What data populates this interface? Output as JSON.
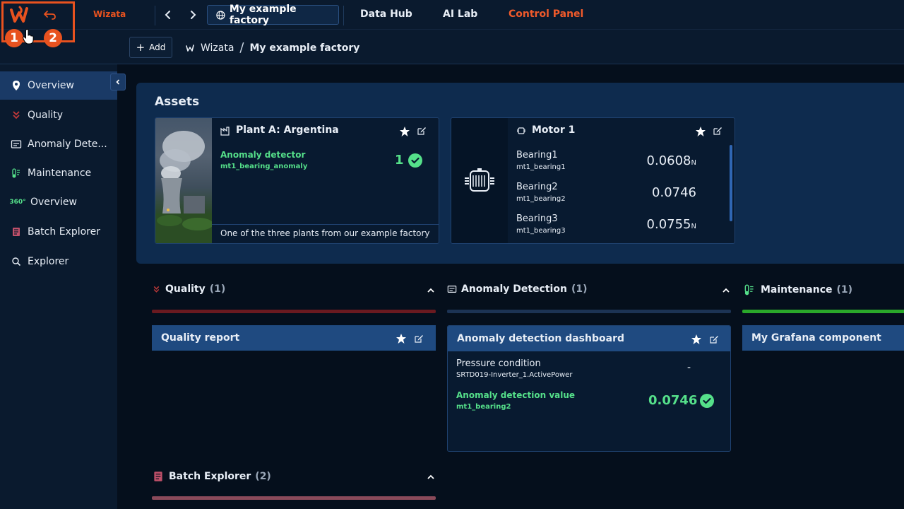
{
  "topbar": {
    "brand": "Wizata",
    "badges": [
      "1",
      "2"
    ],
    "factory_label": "My example factory",
    "nav": [
      {
        "label": "Data Hub",
        "active": false
      },
      {
        "label": "AI Lab",
        "active": false
      },
      {
        "label": "Control Panel",
        "active": true
      }
    ]
  },
  "subbar": {
    "add_label": "Add",
    "breadcrumb": [
      "Wizata",
      "My example factory"
    ],
    "breadcrumb_separator": "/"
  },
  "sidebar": {
    "items": [
      {
        "label": "Overview",
        "icon": "map-pin-icon",
        "active": true
      },
      {
        "label": "Quality",
        "icon": "double-chevron-down-icon",
        "active": false
      },
      {
        "label": "Anomaly Dete...",
        "icon": "monitor-icon",
        "active": false
      },
      {
        "label": "Maintenance",
        "icon": "thermometer-icon",
        "active": false
      },
      {
        "label": "Overview",
        "icon": "360-icon",
        "active": false
      },
      {
        "label": "Batch Explorer",
        "icon": "batch-icon",
        "active": false
      },
      {
        "label": "Explorer",
        "icon": "search-icon",
        "active": false
      }
    ],
    "icon_360_text": "360°"
  },
  "assets": {
    "title": "Assets",
    "plant_card": {
      "title": "Plant A: Argentina",
      "detector_label": "Anomaly detector",
      "detector_id": "mt1_bearing_anomaly",
      "detector_value": "1",
      "description": "One of the three plants from our example factory"
    },
    "motor_card": {
      "title": "Motor 1",
      "rows": [
        {
          "label": "Bearing1",
          "id": "mt1_bearing1",
          "value": "0.0608",
          "unit": "N"
        },
        {
          "label": "Bearing2",
          "id": "mt1_bearing2",
          "value": "0.0746",
          "unit": ""
        },
        {
          "label": "Bearing3",
          "id": "mt1_bearing3",
          "value": "0.0755",
          "unit": "N"
        }
      ]
    }
  },
  "sections": {
    "quality": {
      "title": "Quality",
      "count": "(1)",
      "widget": "Quality report",
      "color": "#6a1a20"
    },
    "anomaly": {
      "title": "Anomaly Detection",
      "count": "(1)",
      "widget": "Anomaly detection dashboard",
      "color": "#1c3354",
      "pressure_label": "Pressure condition",
      "pressure_id": "SRTD019-Inverter_1.ActivePower",
      "pressure_value": "-",
      "value_label": "Anomaly detection value",
      "value_id": "mt1_bearing2",
      "value": "0.0746"
    },
    "maintenance": {
      "title": "Maintenance",
      "count": "(1)",
      "widget": "My Grafana component",
      "color": "#2aa82a"
    },
    "batch": {
      "title": "Batch Explorer",
      "count": "(2)",
      "color": "#8a4a5a"
    }
  },
  "colors": {
    "accent": "#e8521f",
    "active_nav": "#f05a2b",
    "green_value": "#55e08a",
    "panel": "#0e2b4e"
  }
}
